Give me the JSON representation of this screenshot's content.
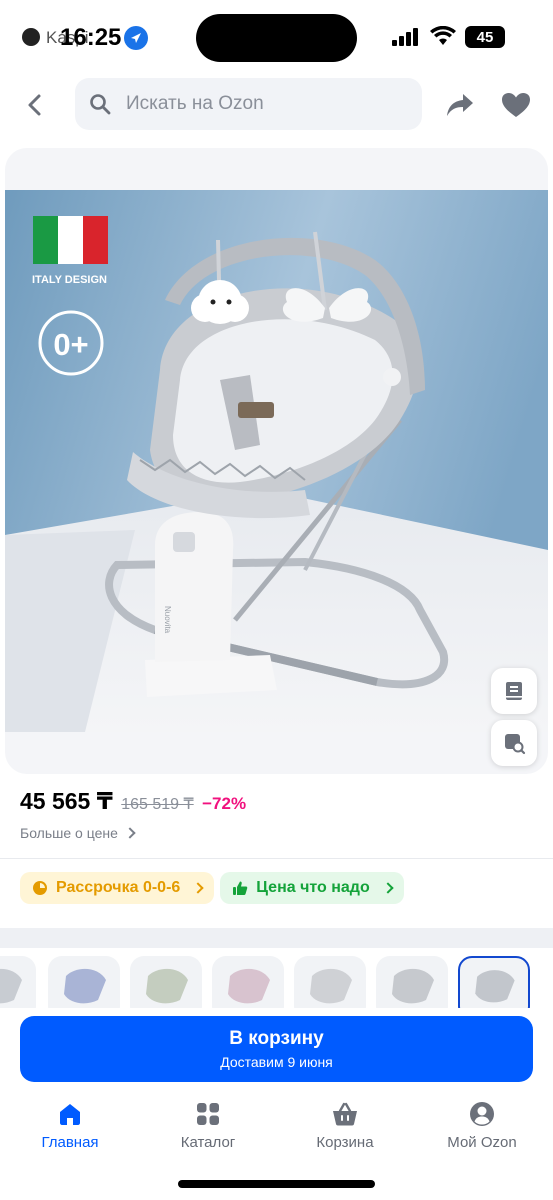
{
  "status_bar": {
    "app_label": "Kaspi",
    "time": "16:25",
    "battery": "45"
  },
  "search": {
    "placeholder": "Искать на Ozon"
  },
  "product": {
    "badge_italy": "ITALY DESIGN",
    "badge_age": "0+",
    "brand_on_base": "Nuovita"
  },
  "price": {
    "current": "45 565 ₸",
    "old": "165 519 ₸",
    "discount": "−72%",
    "more_link": "Больше о цене"
  },
  "chips": {
    "credit": "Рассрочка 0-0-6",
    "fair_price": "Цена что надо"
  },
  "cart": {
    "title": "В корзину",
    "delivery": "Доставим 9 июня"
  },
  "tabs": {
    "home": "Главная",
    "catalog": "Каталог",
    "cart": "Корзина",
    "profile": "Мой Ozon"
  },
  "colors": {
    "brand": "#005bff",
    "discount": "#f1117e",
    "credit_chip": "#e49b00",
    "fair_chip": "#14a33a"
  }
}
